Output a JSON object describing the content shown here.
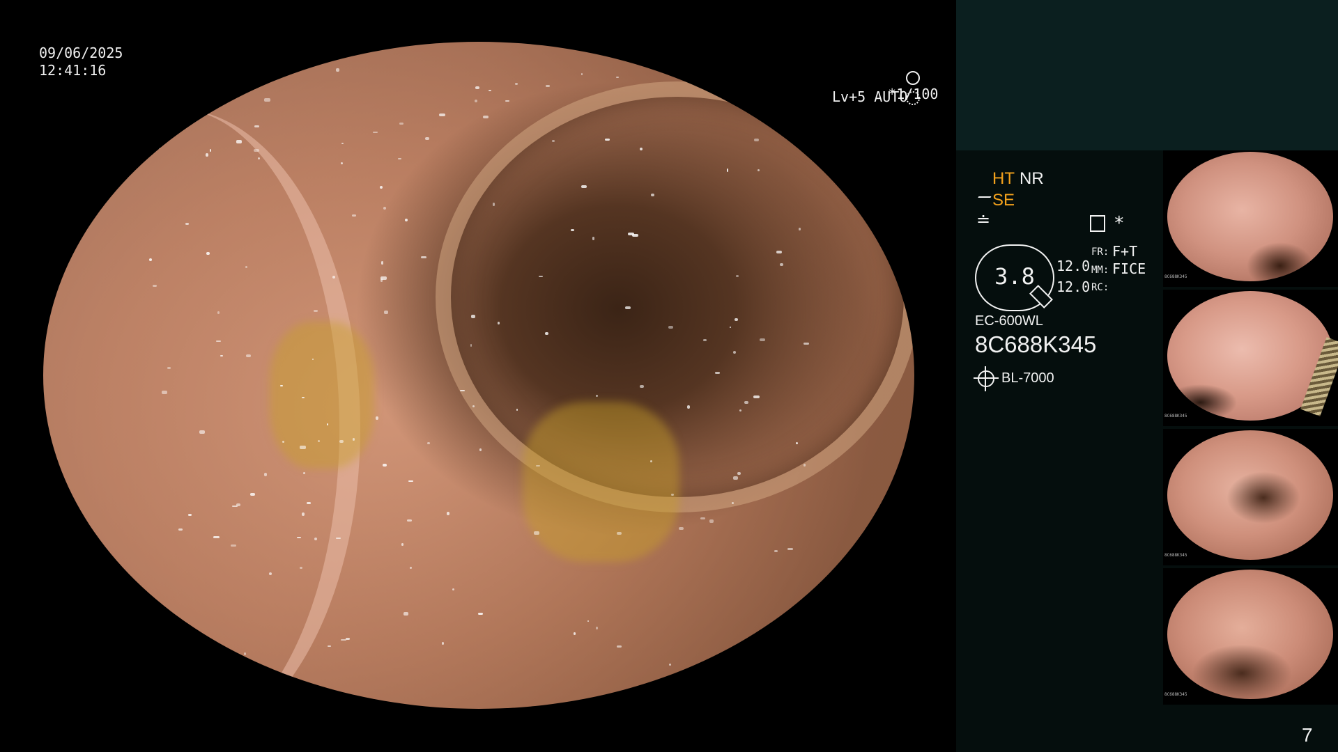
{
  "overlay": {
    "date": "09/06/2025",
    "time": "12:41:16",
    "shutter": "*1/100",
    "level_auto": "Lv+5 AUTO"
  },
  "panel": {
    "ht_label": "HT",
    "nr_label": "NR",
    "se_label": "SE",
    "zoom_value": "3.8",
    "val_top": "12.0",
    "val_bottom": "12.0",
    "fr_label": "FR:",
    "fr_value": "F+T",
    "mm_label": "MM:",
    "mm_value": "FICE",
    "rc_label": "RC:",
    "scope_model": "EC-600WL",
    "scope_serial": "8C688K345",
    "light_source": "BL-7000",
    "asterisk": "*",
    "page_number": "7"
  },
  "colors": {
    "accent_orange": "#f4a21c",
    "panel_bg": "#050e0d",
    "panel_top_bg": "#0b1f1f"
  },
  "thumbnails": [
    {
      "serial": "8C688K345"
    },
    {
      "serial": "8C688K345"
    },
    {
      "serial": "8C688K345"
    },
    {
      "serial": "8C688K345"
    }
  ]
}
